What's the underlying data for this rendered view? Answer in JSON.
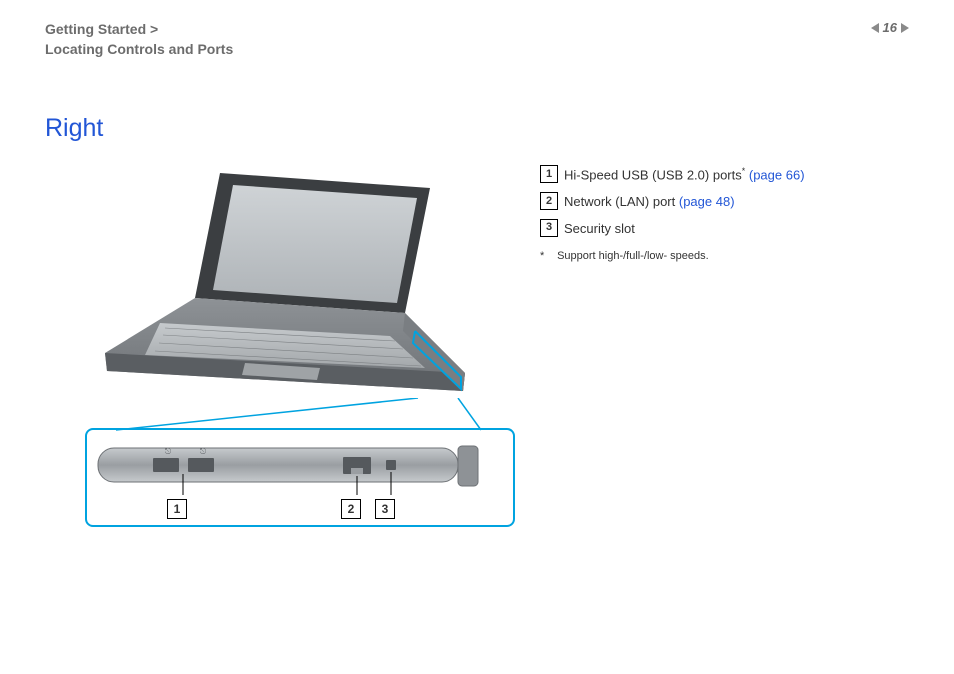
{
  "header": {
    "breadcrumb_1": "Getting Started >",
    "breadcrumb_2": "Locating Controls and Ports",
    "page_number": "16"
  },
  "section": {
    "title": "Right"
  },
  "legend": {
    "items": [
      {
        "num": "1",
        "text": "Hi-Speed USB (USB 2.0) ports",
        "sup": "*",
        "link": "(page 66)"
      },
      {
        "num": "2",
        "text": "Network (LAN) port ",
        "sup": "",
        "link": "(page 48)"
      },
      {
        "num": "3",
        "text": "Security slot",
        "sup": "",
        "link": ""
      }
    ],
    "footnote_mark": "*",
    "footnote_text": "Support high-/full-/low- speeds."
  },
  "figure": {
    "callouts": [
      "1",
      "2",
      "3"
    ]
  }
}
